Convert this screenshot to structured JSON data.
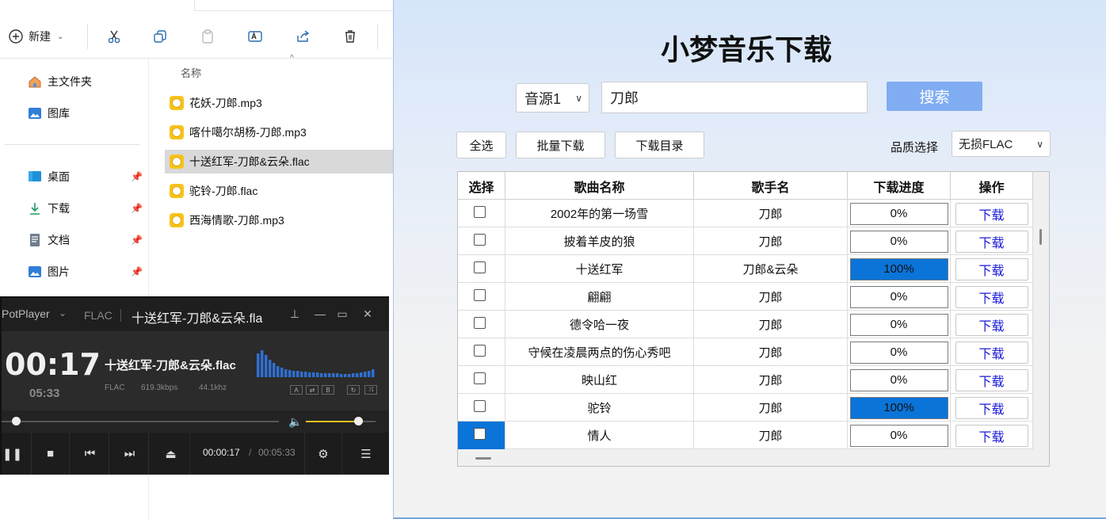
{
  "explorer": {
    "toolbar": {
      "new_label": "新建"
    },
    "nav": [
      {
        "label": "主文件夹",
        "icon": "home-icon"
      },
      {
        "label": "图库",
        "icon": "gallery-icon"
      },
      {
        "label": "桌面",
        "icon": "desktop-icon",
        "pinned": true
      },
      {
        "label": "下载",
        "icon": "download-icon",
        "pinned": true
      },
      {
        "label": "文档",
        "icon": "document-icon",
        "pinned": true
      },
      {
        "label": "图片",
        "icon": "pictures-icon",
        "pinned": true
      }
    ],
    "column_name": "名称",
    "files": [
      {
        "name": "花妖-刀郎.mp3"
      },
      {
        "name": "喀什噶尔胡杨-刀郎.mp3"
      },
      {
        "name": "十送红军-刀郎&云朵.flac",
        "selected": true
      },
      {
        "name": "驼铃-刀郎.flac"
      },
      {
        "name": "西海情歌-刀郎.mp3"
      }
    ]
  },
  "player": {
    "brand": "PotPlayer",
    "format": "FLAC",
    "window_title": "十送红军-刀郎&云朵.fla",
    "current_time_big": "00:17",
    "total_time_small": "05:33",
    "song_title": "十送红军-刀郎&云朵.flac",
    "meta_format": "FLAC",
    "meta_bitrate": "619.3kbps",
    "meta_rate": "44.1khz",
    "mini_a": "A",
    "mini_b": "B",
    "elapsed": "00:00:17",
    "slash": "/",
    "duration": "00:05:33",
    "seek_fraction": 0.05,
    "volume_fraction": 0.75
  },
  "app": {
    "title": "小梦音乐下载",
    "source_select": "音源1",
    "search_value": "刀郎",
    "search_button": "搜索",
    "select_all": "全选",
    "batch_download": "批量下载",
    "download_dir": "下载目录",
    "quality_label": "品质选择",
    "quality_value": "无损FLAC",
    "accent": "#0a74d8",
    "columns": [
      "选择",
      "歌曲名称",
      "歌手名",
      "下载进度",
      "操作"
    ],
    "rows": [
      {
        "song": "2002年的第一场雪",
        "artist": "刀郎",
        "progress": "0%",
        "action": "下载"
      },
      {
        "song": "披着羊皮的狼",
        "artist": "刀郎",
        "progress": "0%",
        "action": "下载"
      },
      {
        "song": "十送红军",
        "artist": "刀郎&云朵",
        "progress": "100%",
        "action": "下载"
      },
      {
        "song": "翩翩",
        "artist": "刀郎",
        "progress": "0%",
        "action": "下载"
      },
      {
        "song": "德令哈一夜",
        "artist": "刀郎",
        "progress": "0%",
        "action": "下载"
      },
      {
        "song": "守候在凌晨两点的伤心秀吧",
        "artist": "刀郎",
        "progress": "0%",
        "action": "下载"
      },
      {
        "song": "映山红",
        "artist": "刀郎",
        "progress": "0%",
        "action": "下载"
      },
      {
        "song": "驼铃",
        "artist": "刀郎",
        "progress": "100%",
        "action": "下载"
      },
      {
        "song": "情人",
        "artist": "刀郎",
        "progress": "0%",
        "action": "下载",
        "highlight": true
      }
    ]
  }
}
